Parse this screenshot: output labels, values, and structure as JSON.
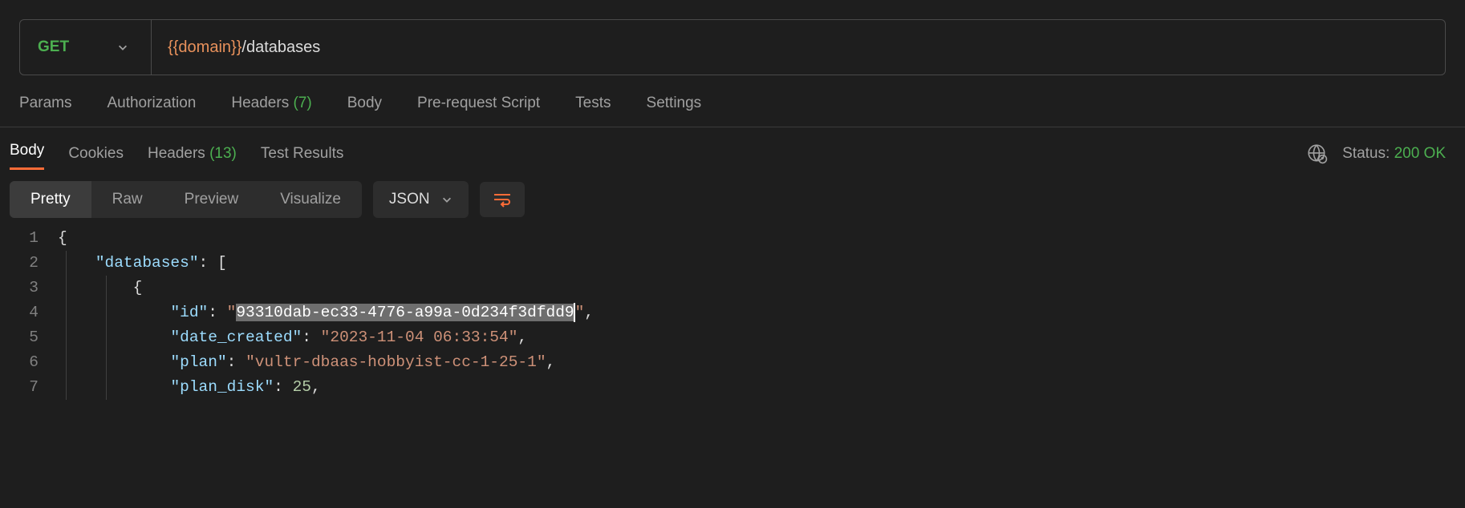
{
  "request": {
    "method": "GET",
    "url_variable": "{{domain}}",
    "url_path": "/databases"
  },
  "request_tabs": {
    "params": "Params",
    "authorization": "Authorization",
    "headers_label": "Headers",
    "headers_count": "(7)",
    "body": "Body",
    "prerequest": "Pre-request Script",
    "tests": "Tests",
    "settings": "Settings"
  },
  "response_tabs": {
    "body": "Body",
    "cookies": "Cookies",
    "headers_label": "Headers",
    "headers_count": "(13)",
    "test_results": "Test Results"
  },
  "status": {
    "label": "Status:",
    "value": "200 OK"
  },
  "format": {
    "pretty": "Pretty",
    "raw": "Raw",
    "preview": "Preview",
    "visualize": "Visualize",
    "language": "JSON"
  },
  "code_lines": {
    "l1": "1",
    "l2": "2",
    "l3": "3",
    "l4": "4",
    "l5": "5",
    "l6": "6",
    "l7": "7"
  },
  "response_body": {
    "databases_key": "\"databases\"",
    "id_key": "\"id\"",
    "id_value": "93310dab-ec33-4776-a99a-0d234f3dfdd9",
    "date_created_key": "\"date_created\"",
    "date_created_value": "\"2023-11-04 06:33:54\"",
    "plan_key": "\"plan\"",
    "plan_value": "\"vultr-dbaas-hobbyist-cc-1-25-1\"",
    "plan_disk_key": "\"plan_disk\"",
    "plan_disk_value": "25"
  }
}
